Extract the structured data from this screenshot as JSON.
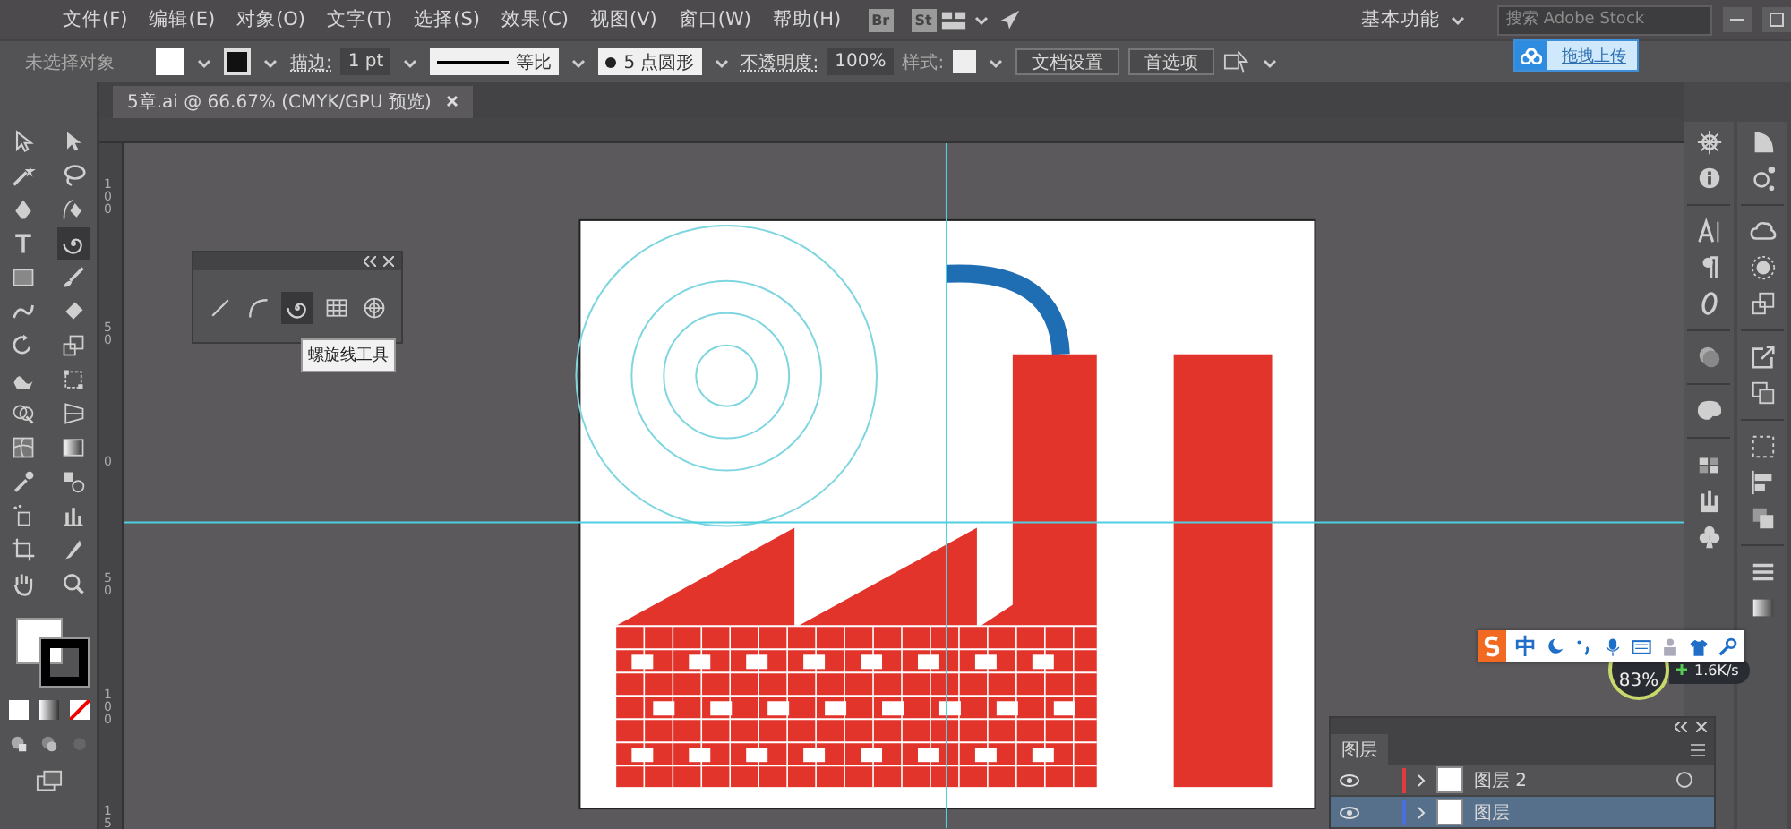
{
  "menu_bar": {
    "items": [
      "文件(F)",
      "编辑(E)",
      "对象(O)",
      "文字(T)",
      "选择(S)",
      "效果(C)",
      "视图(V)",
      "窗口(W)",
      "帮助(H)"
    ],
    "app_badges": [
      "Br",
      "St"
    ],
    "workspace": "基本功能",
    "search": {
      "placeholder": "搜索 Adobe Stock"
    }
  },
  "upload_widget": {
    "label": "拖拽上传"
  },
  "control_bar": {
    "selection": "未选择对象",
    "stroke_label": "描边:",
    "stroke_weight": "1 pt",
    "stroke_profile": "等比",
    "brush": "5 点圆形",
    "opacity_label": "不透明度:",
    "opacity": "100%",
    "style_label": "样式:",
    "buttons": [
      "文档设置",
      "首选项"
    ]
  },
  "document_tab": {
    "title": "5章.ai @ 66.67% (CMYK/GPU 预览)",
    "selected": true
  },
  "vertical_ruler": {
    "labels": [
      "100",
      "50",
      "0",
      "50",
      "100",
      "15"
    ]
  },
  "tools": [
    {
      "kind": "select",
      "selected": false
    },
    {
      "kind": "direct",
      "selected": false
    },
    {
      "kind": "wand",
      "selected": false
    },
    {
      "kind": "lasso",
      "selected": false
    },
    {
      "kind": "pen",
      "selected": false
    },
    {
      "kind": "curvature",
      "selected": false
    },
    {
      "kind": "type",
      "selected": false
    },
    {
      "kind": "spiral",
      "selected": true
    },
    {
      "kind": "rect",
      "selected": false
    },
    {
      "kind": "brush",
      "selected": false
    },
    {
      "kind": "shaper",
      "selected": false
    },
    {
      "kind": "eraser",
      "selected": false
    },
    {
      "kind": "rotate",
      "selected": false
    },
    {
      "kind": "scale",
      "selected": false
    },
    {
      "kind": "warp",
      "selected": false
    },
    {
      "kind": "transform",
      "selected": false
    },
    {
      "kind": "builder",
      "selected": false
    },
    {
      "kind": "perspective",
      "selected": false
    },
    {
      "kind": "mesh",
      "selected": false
    },
    {
      "kind": "gradient",
      "selected": false
    },
    {
      "kind": "eyedropper",
      "selected": false
    },
    {
      "kind": "blend",
      "selected": false
    },
    {
      "kind": "sprayer",
      "selected": false
    },
    {
      "kind": "graph",
      "selected": false
    },
    {
      "kind": "artboard",
      "selected": false
    },
    {
      "kind": "slice",
      "selected": false
    },
    {
      "kind": "hand",
      "selected": false
    },
    {
      "kind": "zoom",
      "selected": false
    }
  ],
  "flyout_panel": {
    "tools": [
      {
        "kind": "line",
        "selected": false
      },
      {
        "kind": "arc",
        "selected": false
      },
      {
        "kind": "spiral",
        "selected": true
      },
      {
        "kind": "grid",
        "selected": false
      },
      {
        "kind": "polar",
        "selected": false
      }
    ],
    "tooltip": "螺旋线工具"
  },
  "ime_bar": {
    "mode": "中"
  },
  "net_meter": {
    "percent": "83%",
    "speed": "1.6K/s"
  },
  "layers_panel": {
    "title": "图层",
    "rows": [
      {
        "name": "图层 2",
        "color": "#e03c3c",
        "selected": false
      },
      {
        "name": "图层",
        "color": "#4a6ee0",
        "selected": true
      }
    ]
  }
}
